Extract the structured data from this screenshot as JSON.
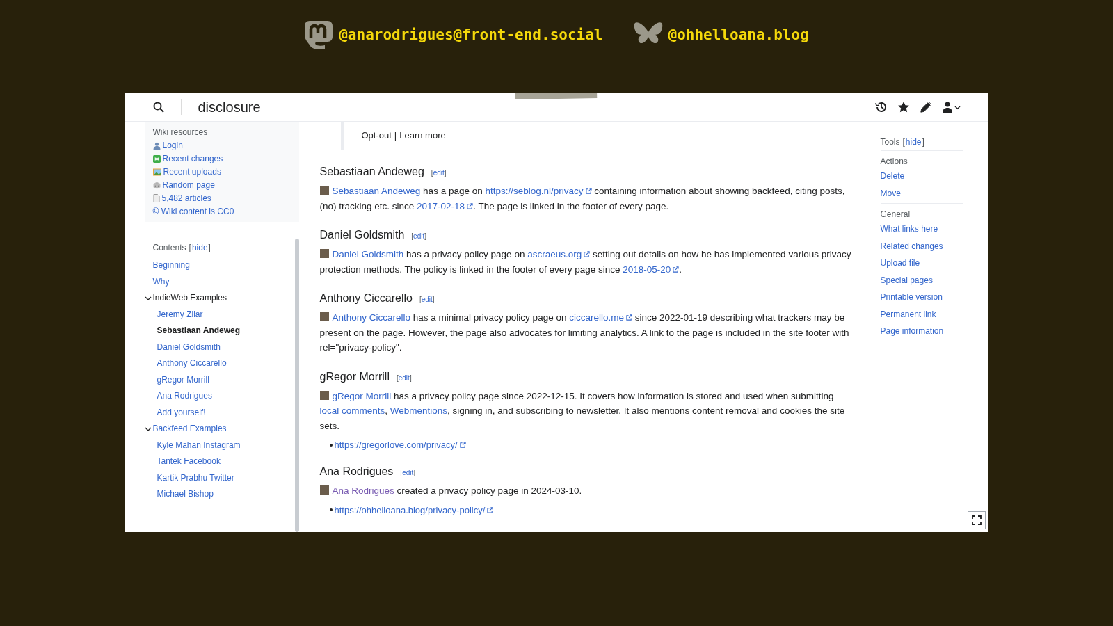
{
  "social": [
    {
      "kind": "mastodon",
      "handle": "@anarodrigues@front-end.social"
    },
    {
      "kind": "bluesky",
      "handle": "@ohhelloana.blog"
    }
  ],
  "header": {
    "title": "disclosure"
  },
  "resources": {
    "title": "Wiki resources",
    "items": [
      "Login",
      "Recent changes",
      "Recent uploads",
      "Random page",
      "5,482 articles",
      "© Wiki content is CC0"
    ]
  },
  "contents": {
    "title": "Contents",
    "toggle": {
      "open": "[",
      "label": "hide",
      "close": "]"
    },
    "items": [
      {
        "label": "Beginning",
        "selected": false
      },
      {
        "label": "Why",
        "selected": false
      },
      {
        "label": "IndieWeb Examples",
        "selected": false,
        "expanded": true,
        "children": [
          {
            "label": "Jeremy Zilar",
            "selected": false
          },
          {
            "label": "Sebastiaan Andeweg",
            "selected": true
          },
          {
            "label": "Daniel Goldsmith",
            "selected": false
          },
          {
            "label": "Anthony Ciccarello",
            "selected": false
          },
          {
            "label": "gRegor Morrill",
            "selected": false
          },
          {
            "label": "Ana Rodrigues",
            "selected": false
          },
          {
            "label": "Add yourself!",
            "selected": false
          }
        ]
      },
      {
        "label": "Backfeed Examples",
        "selected": false,
        "expanded": true,
        "children": [
          {
            "label": "Kyle Mahan Instagram",
            "selected": false
          },
          {
            "label": "Tantek Facebook",
            "selected": false
          },
          {
            "label": "Kartik Prabhu Twitter",
            "selected": false
          },
          {
            "label": "Michael Bishop",
            "selected": false
          }
        ]
      }
    ]
  },
  "notice": {
    "links": [
      "Opt-out",
      "Learn more"
    ],
    "separator": "|"
  },
  "sections": [
    {
      "heading": "Sebastiaan Andeweg",
      "edit": {
        "open": "[",
        "label": "edit",
        "close": "]"
      },
      "paragraph": [
        {
          "kind": "link",
          "text": "Sebastiaan Andeweg"
        },
        {
          "kind": "text",
          "text": " has a page on "
        },
        {
          "kind": "external",
          "text": "https://seblog.nl/privacy"
        },
        {
          "kind": "text",
          "text": " containing information about showing backfeed, citing posts, (no) tracking etc. since "
        },
        {
          "kind": "external",
          "text": "2017-02-18"
        },
        {
          "kind": "text",
          "text": ". The page is linked in the footer of every page."
        }
      ]
    },
    {
      "heading": "Daniel Goldsmith",
      "edit": {
        "open": "[",
        "label": "edit",
        "close": "]"
      },
      "paragraph": [
        {
          "kind": "link",
          "text": "Daniel Goldsmith"
        },
        {
          "kind": "text",
          "text": " has a privacy policy page on "
        },
        {
          "kind": "external",
          "text": "ascraeus.org"
        },
        {
          "kind": "text",
          "text": " setting out details on how he has implemented various privacy protection methods. The policy is linked in the footer of every page since "
        },
        {
          "kind": "external",
          "text": "2018-05-20"
        },
        {
          "kind": "text",
          "text": "."
        }
      ]
    },
    {
      "heading": "Anthony Ciccarello",
      "edit": {
        "open": "[",
        "label": "edit",
        "close": "]"
      },
      "paragraph": [
        {
          "kind": "link",
          "text": "Anthony Ciccarello"
        },
        {
          "kind": "text",
          "text": " has a minimal privacy policy page on "
        },
        {
          "kind": "external",
          "text": "ciccarello.me"
        },
        {
          "kind": "text",
          "text": " since 2022-01-19 describing what trackers may be present on the page. However, the page also advocates for limiting analytics. A link to the page is included in the site footer with rel=\"privacy-policy\"."
        }
      ]
    },
    {
      "heading": "gRegor Morrill",
      "edit": {
        "open": "[",
        "label": "edit",
        "close": "]"
      },
      "paragraph": [
        {
          "kind": "link",
          "text": "gRegor Morrill"
        },
        {
          "kind": "text",
          "text": " has a privacy policy page since 2022-12-15. It covers how information is stored and used when submitting "
        },
        {
          "kind": "link",
          "text": "local comments"
        },
        {
          "kind": "text",
          "text": ", "
        },
        {
          "kind": "link",
          "text": "Webmentions"
        },
        {
          "kind": "text",
          "text": ", signing in, and subscribing to newsletter. It also mentions content removal and cookies the site sets."
        }
      ],
      "bullets": [
        "https://gregorlove.com/privacy/"
      ]
    },
    {
      "heading": "Ana Rodrigues",
      "edit": {
        "open": "[",
        "label": "edit",
        "close": "]"
      },
      "paragraph": [
        {
          "kind": "visited",
          "text": "Ana Rodrigues"
        },
        {
          "kind": "text",
          "text": " created a privacy policy page in 2024-03-10."
        }
      ],
      "bullets": [
        "https://ohhelloana.blog/privacy-policy/"
      ]
    }
  ],
  "tools": {
    "title": "Tools",
    "toggle": {
      "open": "[",
      "label": "hide",
      "close": "]"
    },
    "groups": [
      {
        "title": "Actions",
        "items": [
          "Delete",
          "Move"
        ]
      },
      {
        "title": "General",
        "items": [
          "What links here",
          "Related changes",
          "Upload file",
          "Special pages",
          "Printable version",
          "Permanent link",
          "Page information"
        ]
      }
    ]
  }
}
